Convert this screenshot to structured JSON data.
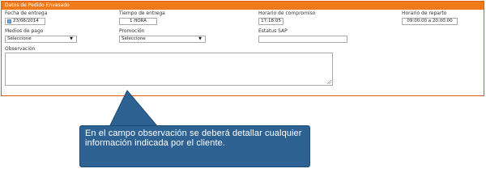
{
  "panel": {
    "title": "Datos de Pedido Envasado",
    "fecha_entrega": {
      "label": "Fecha de entrega",
      "value": "23/06/2014"
    },
    "tiempo_entrega": {
      "label": "Tiempo de entrega",
      "value": "1 HORA"
    },
    "horario_compromiso": {
      "label": "Horario de compromiso",
      "value": "17:18:05"
    },
    "horario_reparto": {
      "label": "Horario de reparto",
      "value": "09:00:00 a 20:00:00"
    },
    "medios_pago": {
      "label": "Medios de pago",
      "value": "Seleccione"
    },
    "promocion": {
      "label": "Promoción",
      "value": "Seleccione"
    },
    "estatus_sap": {
      "label": "Estatus SAP",
      "value": ""
    },
    "observacion": {
      "label": "Observación",
      "value": ""
    }
  },
  "callout": {
    "text": "En el campo observación se deberá detallar cualquier información indicada por el cliente."
  },
  "colors": {
    "header": "#f07a1a",
    "panel_border": "#e05a10",
    "callout_bg": "#2e6293"
  },
  "icons": {
    "calendar": "calendar-icon",
    "dropdown": "chevron-down-icon"
  }
}
